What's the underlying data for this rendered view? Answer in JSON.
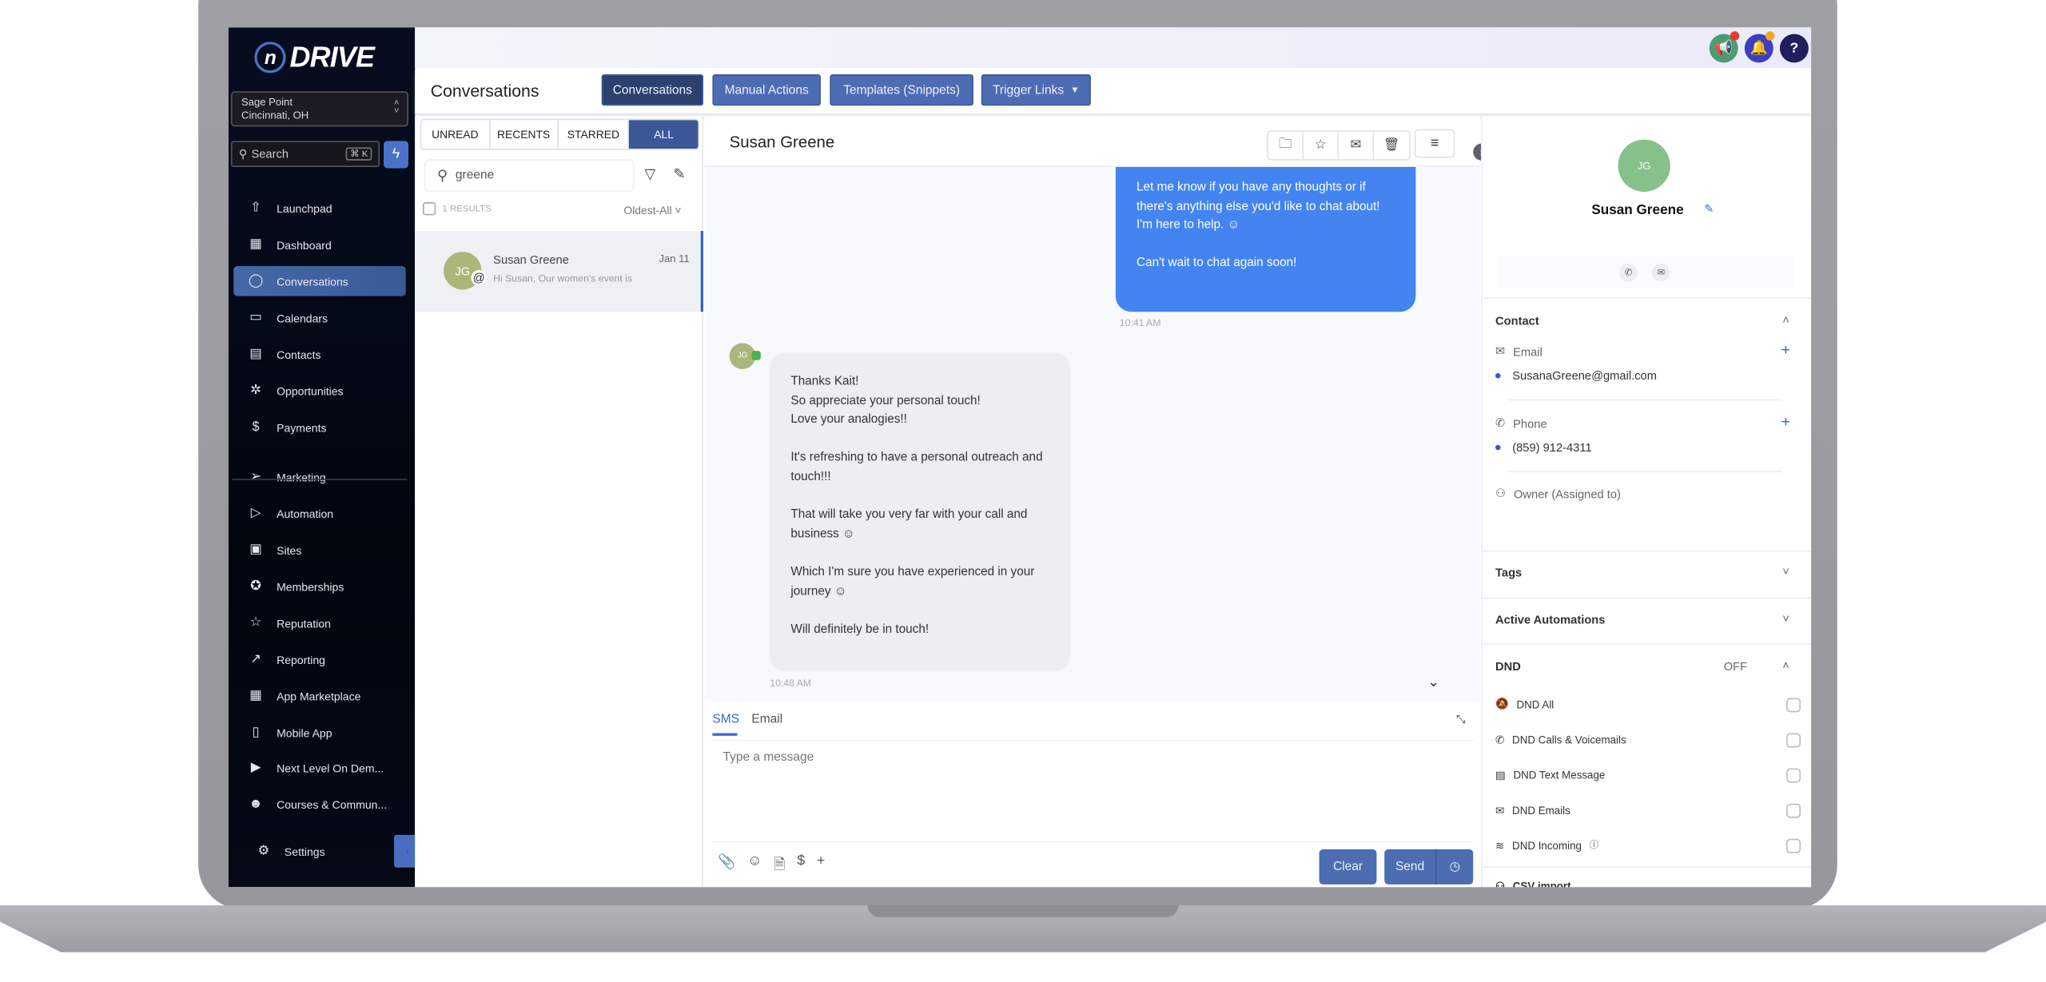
{
  "brand": {
    "logo_mark": "n",
    "logo_text": "DRIVE"
  },
  "location": {
    "name": "Sage Point",
    "city": "Cincinnati, OH"
  },
  "sidebar_search": {
    "placeholder": "Search",
    "shortcut": "⌘ K"
  },
  "nav": [
    {
      "label": "Launchpad",
      "icon": "launchpad-icon",
      "glyph": "⇧"
    },
    {
      "label": "Dashboard",
      "icon": "dashboard-icon",
      "glyph": "▦"
    },
    {
      "label": "Conversations",
      "icon": "chat-bubble-icon",
      "glyph": "◯",
      "active": true
    },
    {
      "label": "Calendars",
      "icon": "calendar-icon",
      "glyph": "▭"
    },
    {
      "label": "Contacts",
      "icon": "contacts-icon",
      "glyph": "▤"
    },
    {
      "label": "Opportunities",
      "icon": "opportunities-icon",
      "glyph": "✲"
    },
    {
      "label": "Payments",
      "icon": "payments-icon",
      "glyph": "$"
    },
    {
      "label": "Marketing",
      "icon": "send-icon",
      "glyph": "➢"
    },
    {
      "label": "Automation",
      "icon": "automation-icon",
      "glyph": "▷"
    },
    {
      "label": "Sites",
      "icon": "sites-icon",
      "glyph": "▣"
    },
    {
      "label": "Memberships",
      "icon": "membership-badge-icon",
      "glyph": "✪"
    },
    {
      "label": "Reputation",
      "icon": "star-icon",
      "glyph": "☆"
    },
    {
      "label": "Reporting",
      "icon": "trend-icon",
      "glyph": "↗"
    },
    {
      "label": "App Marketplace",
      "icon": "apps-grid-icon",
      "glyph": "▦"
    },
    {
      "label": "Mobile App",
      "icon": "mobile-icon",
      "glyph": "▯"
    },
    {
      "label": "Next Level On Dem...",
      "icon": "video-icon",
      "glyph": "▶"
    },
    {
      "label": "Courses & Commun...",
      "icon": "users-icon",
      "glyph": "☻"
    }
  ],
  "settings_label": "Settings",
  "header": {
    "title": "Conversations",
    "tabs": [
      "Conversations",
      "Manual Actions",
      "Templates (Snippets)",
      "Trigger Links"
    ]
  },
  "list": {
    "filters": [
      "UNREAD",
      "RECENTS",
      "STARRED",
      "ALL"
    ],
    "search_value": "greene",
    "results": "1 RESULTS",
    "sort": "Oldest-All",
    "items": [
      {
        "initials": "JG",
        "name": "Susan Greene",
        "date": "Jan 11",
        "preview": "Hi Susan, Our women's event is"
      }
    ]
  },
  "chat": {
    "title": "Susan Greene",
    "messages": [
      {
        "direction": "outbound",
        "text": "Let me know if you have any thoughts or if there's anything else you'd like to chat about! I'm here to help. ☺\n\nCan't wait to chat again soon!",
        "time": "10:41 AM"
      },
      {
        "direction": "inbound",
        "initials": "JG",
        "text": "Thanks Kait!\nSo appreciate your personal touch!\nLove your analogies!!\n\nIt's refreshing to have a personal outreach and touch!!!\n\nThat will take you very far with your call and business ☺\n\nWhich I'm sure you have experienced in your journey ☺\n\nWill definitely be in touch!",
        "time": "10:48 AM"
      }
    ],
    "compose": {
      "tabs": [
        "SMS",
        "Email"
      ],
      "placeholder": "Type a message",
      "clear": "Clear",
      "send": "Send"
    }
  },
  "contact": {
    "initials": "JG",
    "name": "Susan Greene",
    "section": "Contact",
    "email_label": "Email",
    "email": "SusanaGreene@gmail.com",
    "phone_label": "Phone",
    "phone": "(859) 912-4311",
    "owner_label": "Owner (Assigned to)",
    "tags": "Tags",
    "automations": "Active Automations",
    "dnd": {
      "label": "DND",
      "status": "OFF",
      "options": [
        "DND All",
        "DND Calls & Voicemails",
        "DND Text Message",
        "DND Emails",
        "DND Incoming"
      ]
    },
    "csv": "CSV import"
  },
  "colors": {
    "accent": "#4d6db3",
    "active": "#2c416d",
    "bubble_out": "#4384f1",
    "sidebar": "#050915"
  }
}
